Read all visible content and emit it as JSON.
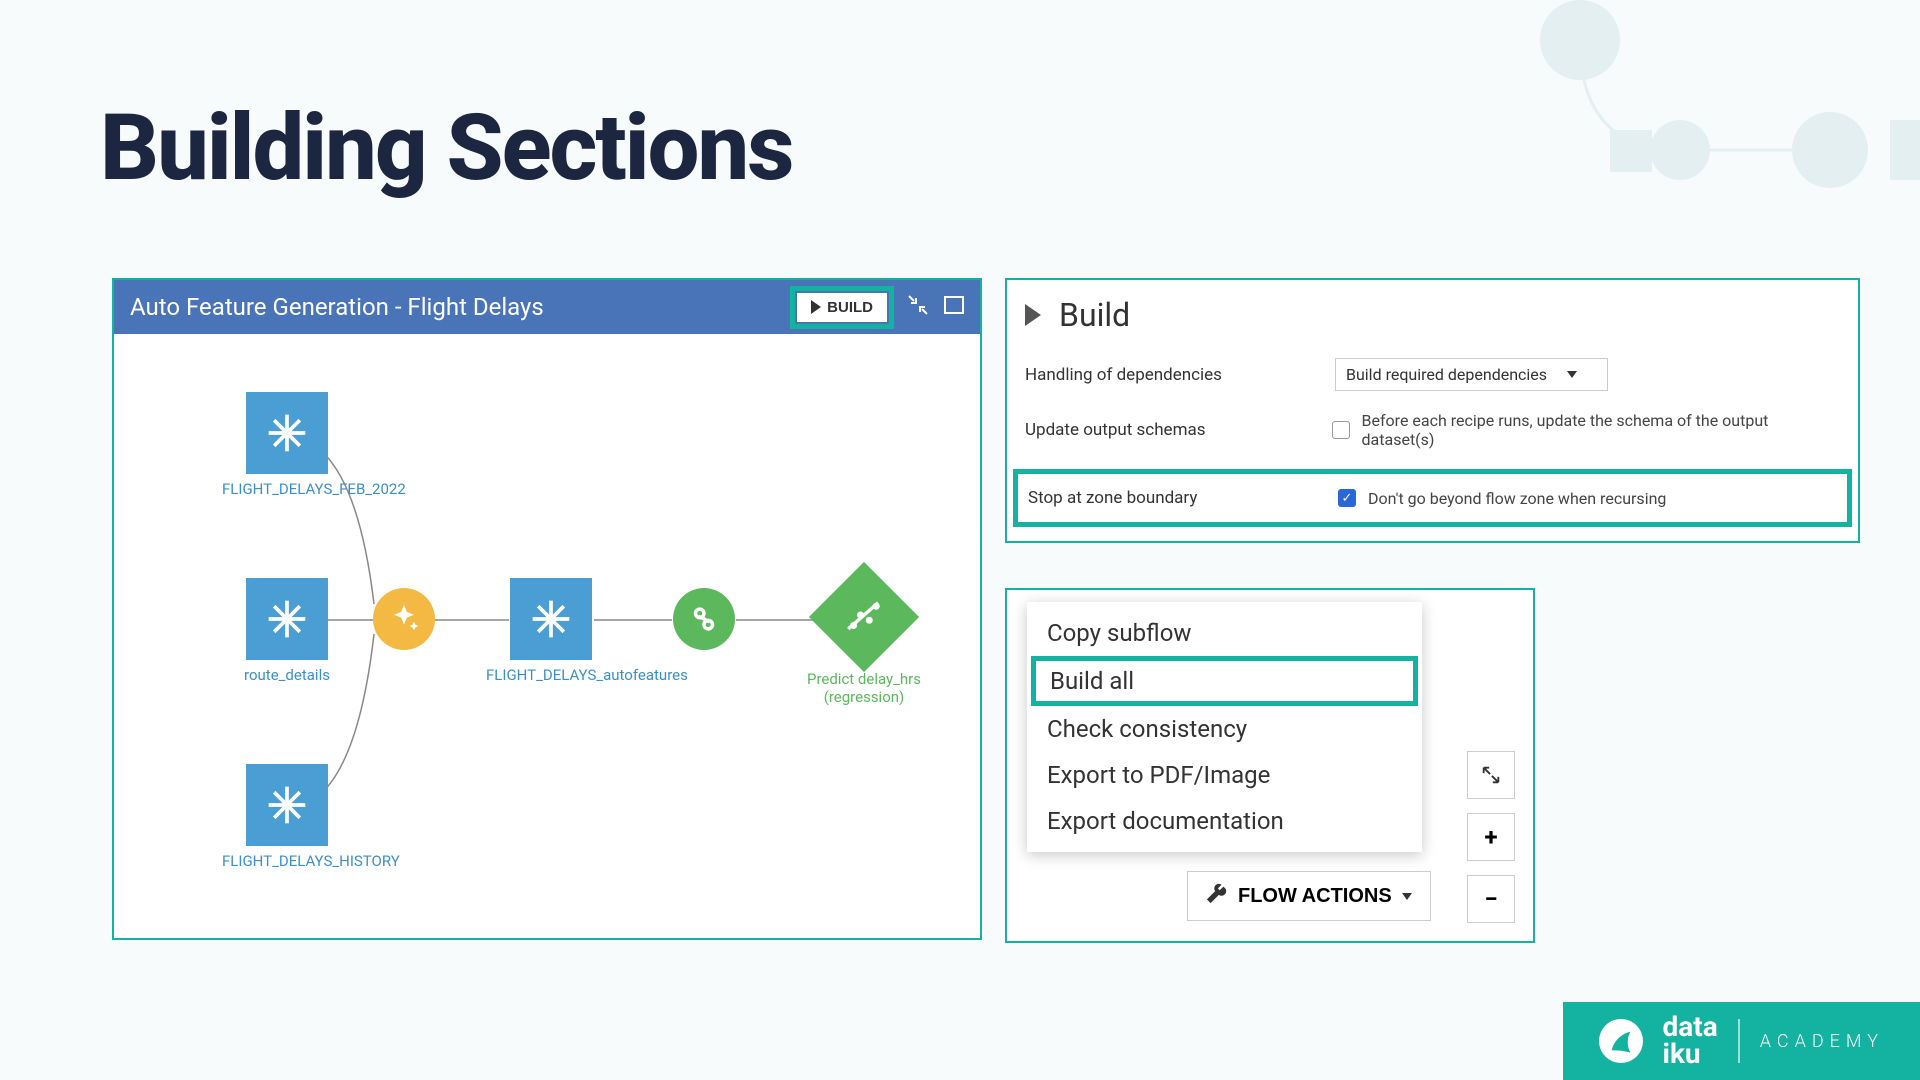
{
  "page_title": "Building Sections",
  "flow": {
    "title": "Auto Feature Generation - Flight Delays",
    "build_button": "BUILD",
    "datasets": {
      "feb22": "FLIGHT_DELAYS_FEB_2022",
      "route": "route_details",
      "history": "FLIGHT_DELAYS_HISTORY",
      "autofeat": "FLIGHT_DELAYS_autofeatures"
    },
    "predict_label": "Predict delay_hrs (regression)"
  },
  "build_panel": {
    "heading": "Build",
    "rows": {
      "dependencies_label": "Handling of dependencies",
      "dependencies_value": "Build required dependencies",
      "update_schemas_label": "Update output schemas",
      "update_schemas_hint": "Before each recipe runs, update the schema of the output dataset(s)",
      "stop_zone_label": "Stop at zone boundary",
      "stop_zone_hint": "Don't go beyond flow zone when recursing"
    }
  },
  "actions": {
    "menu": {
      "copy": "Copy subflow",
      "build_all": "Build all",
      "check": "Check consistency",
      "export_pdf": "Export to PDF/Image",
      "export_doc": "Export documentation"
    },
    "flow_actions_btn": "FLOW ACTIONS"
  },
  "brand": {
    "name_top": "data",
    "name_bot": "iku",
    "sub": "ACADEMY"
  }
}
